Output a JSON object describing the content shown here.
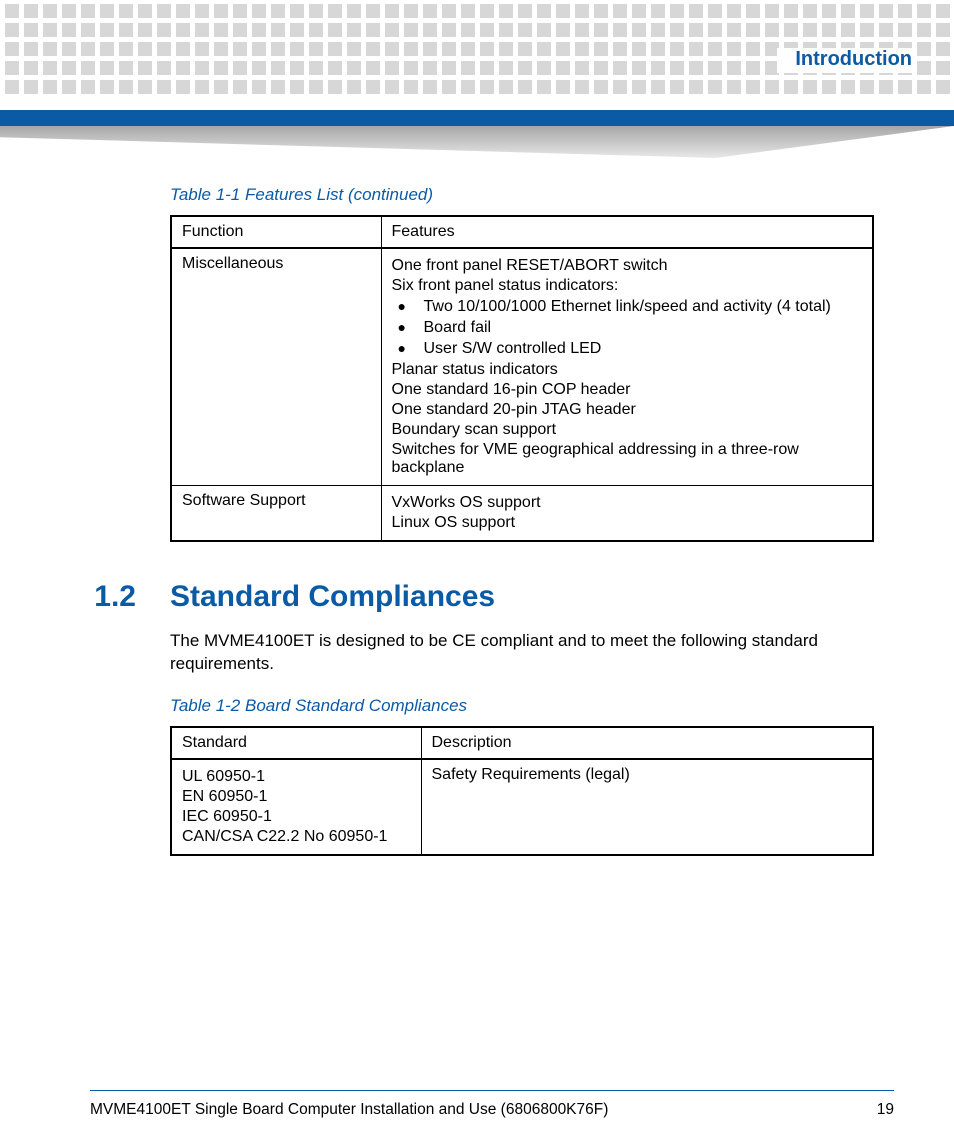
{
  "header": {
    "chapter": "Introduction"
  },
  "table1": {
    "caption": "Table 1-1 Features List (continued)",
    "headers": {
      "col1": "Function",
      "col2": "Features"
    },
    "rows": [
      {
        "func": "Miscellaneous",
        "lines_before": [
          "One front panel RESET/ABORT switch",
          "Six front panel status indicators:"
        ],
        "bullets": [
          "Two 10/100/1000 Ethernet link/speed and activity (4 total)",
          "Board fail",
          "User S/W controlled LED"
        ],
        "lines_after": [
          "Planar status indicators",
          "One standard 16-pin COP header",
          "One standard 20-pin JTAG header",
          "Boundary scan support",
          "Switches for VME geographical addressing in a three-row backplane"
        ]
      },
      {
        "func": "Software Support",
        "lines_before": [
          "VxWorks OS support",
          "Linux OS support"
        ],
        "bullets": [],
        "lines_after": []
      }
    ]
  },
  "section": {
    "number": "1.2",
    "title": "Standard Compliances",
    "body": "The MVME4100ET is designed to be CE compliant and to meet the following standard requirements."
  },
  "table2": {
    "caption": "Table 1-2 Board Standard Compliances",
    "headers": {
      "col1": "Standard",
      "col2": "Description"
    },
    "rows": [
      {
        "standards": [
          "UL 60950-1",
          "EN 60950-1",
          "IEC 60950-1",
          "CAN/CSA C22.2 No 60950-1"
        ],
        "description": "Safety Requirements (legal)"
      }
    ]
  },
  "footer": {
    "title": "MVME4100ET Single Board Computer Installation and Use (6806800K76F)",
    "page": "19"
  }
}
